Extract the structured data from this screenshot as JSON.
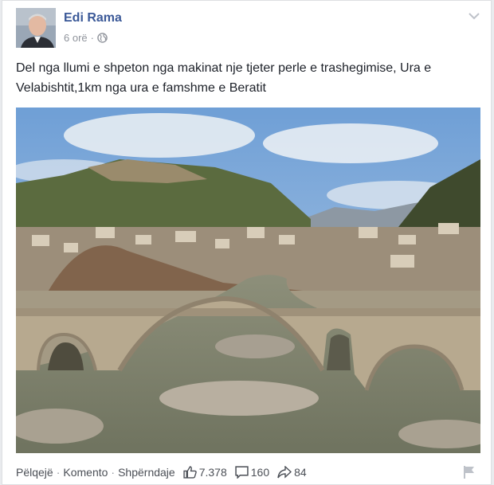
{
  "post": {
    "author": "Edi Rama",
    "time": "6 orë",
    "meta_separator": "·",
    "audience_icon": "globe-icon",
    "options_icon": "chevron-down-icon",
    "text": "Del nga llumi e shpeton nga makinat nje tjeter perle e trashegimise, Ura e Velabishtit,1km nga ura e famshme e Beratit"
  },
  "actions": {
    "like": "Pëlqejë",
    "comment": "Komento",
    "share": "Shpërndaje",
    "separator": "·"
  },
  "counts": {
    "likes": "7.378",
    "comments": "160",
    "shares": "84"
  },
  "colors": {
    "author_link": "#3b5998",
    "meta_gray": "#90949c",
    "text": "#1d2129"
  }
}
